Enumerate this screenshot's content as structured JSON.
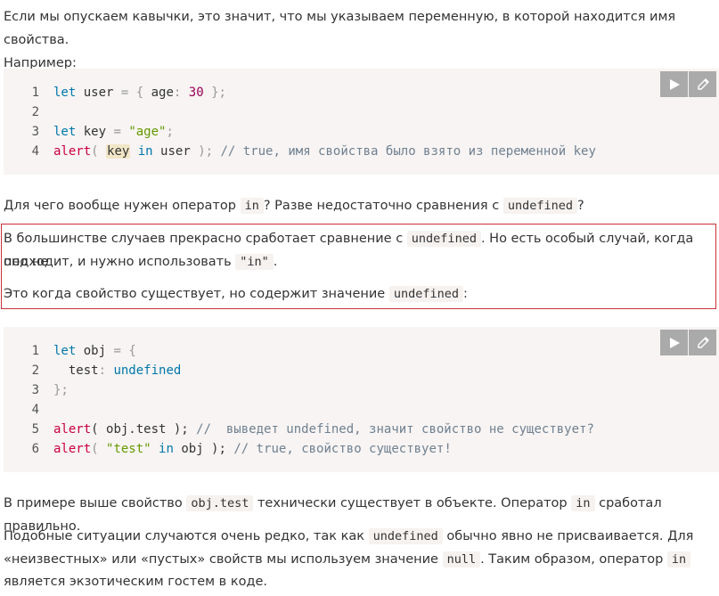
{
  "intro": {
    "line1": "Если мы опускаем кавычки, это значит, что мы указываем переменную, в которой находится имя свойства.",
    "line2": "Например:"
  },
  "code1": {
    "line_numbers": [
      "1",
      "2",
      "3",
      "4"
    ],
    "l1_let": "let",
    "l1_user": " user ",
    "l1_eq": "=",
    "l1_ob": " { ",
    "l1_age": "age",
    "l1_colon": ":",
    "l1_num": " 30",
    "l1_cb": " };",
    "l3_let": "let",
    "l3_key": " key ",
    "l3_eq": "=",
    "l3_str": " \"age\"",
    "l3_semi": ";",
    "l4_alert": "alert",
    "l4_paren": "( ",
    "l4_key": "key",
    "l4_in": " in",
    "l4_user": " user ",
    "l4_close": ");",
    "l4_comment": " // true, имя свойства было взято из переменной key"
  },
  "para2": {
    "before": "Для чего вообще нужен оператор ",
    "code_in": "in",
    "middle": "? Разве недостаточно сравнения с ",
    "code_undef": "undefined",
    "after": "?"
  },
  "note": {
    "l1_before": "В большинстве случаев прекрасно сработает сравнение с ",
    "l1_code": "undefined",
    "l1_after": ". Но есть особый случай, когда оно не",
    "l2_before": "подходит, и нужно использовать ",
    "l2_code": "\"in\"",
    "l2_after": ".",
    "l3_before": "Это когда свойство существует, но содержит значение ",
    "l3_code": "undefined",
    "l3_after": ":"
  },
  "code2": {
    "line_numbers": [
      "1",
      "2",
      "3",
      "4",
      "5",
      "6"
    ],
    "l1_let": "let",
    "l1_obj": " obj ",
    "l1_eq": "=",
    "l1_ob": " {",
    "l2_test": "  test",
    "l2_colon": ":",
    "l2_undef": " undefined",
    "l3_cb": "};",
    "l5_alert": "alert",
    "l5_rest": "( obj.test );",
    "l5_comment": " //  выведет undefined, значит свойство не существует?",
    "l6_alert": "alert",
    "l6_open": "( ",
    "l6_str": "\"test\"",
    "l6_in": " in",
    "l6_rest": " obj );",
    "l6_comment": " // true, свойство существует!"
  },
  "para3": {
    "before": "В примере выше свойство ",
    "code": "obj.test",
    "middle": " технически существует в объекте. Оператор ",
    "code_in": "in",
    "after": " сработал правильно."
  },
  "para4": {
    "l1_before": "Подобные ситуации случаются очень редко, так как ",
    "l1_code": "undefined",
    "l1_after": " обычно явно не присваивается. Для",
    "l2_before": "«неизвестных» или «пустых» свойств мы используем значение ",
    "l2_code": "null",
    "l2_middle": ". Таким образом, оператор ",
    "l2_code2": "in",
    "l3": "является экзотическим гостем в коде."
  },
  "toolbar_icons": [
    "run-icon",
    "edit-icon"
  ],
  "colors": {
    "note_border": "#c8323a",
    "code_bg": "#f7f4f3",
    "button_bg": "#aaaaaa"
  }
}
